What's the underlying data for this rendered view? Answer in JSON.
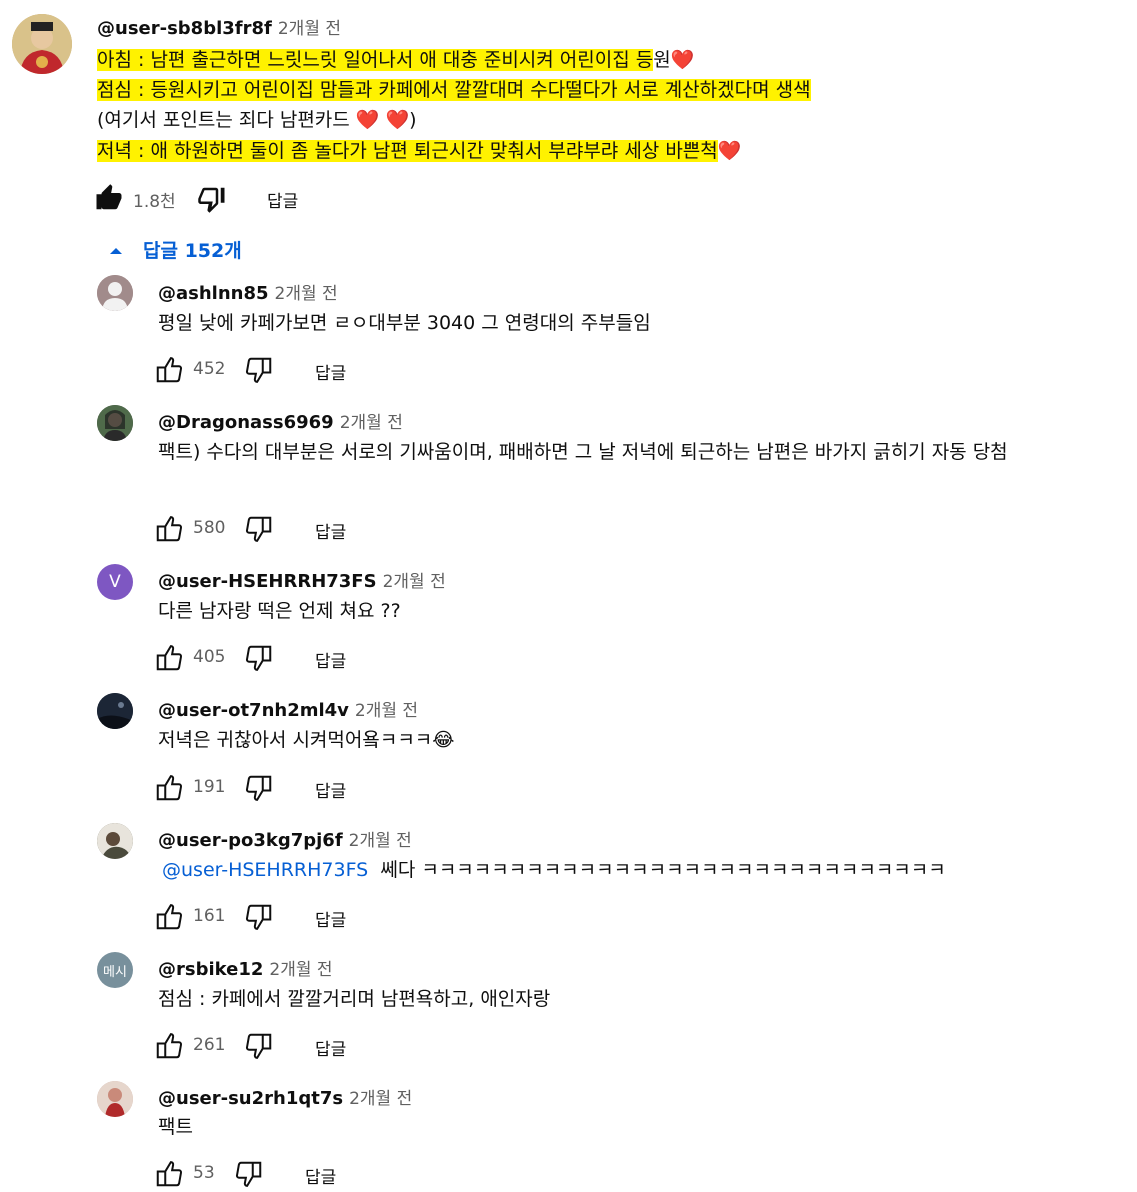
{
  "main_comment": {
    "author": "@user-sb8bl3fr8f",
    "time": "2개월 전",
    "lines": [
      {
        "label": "아침 : ",
        "hl_text": "남편 출근하면 느릿느릿 일어나서 애 대충 준비시켜 어린이집 등",
        "tail": "원"
      },
      {
        "label": "점심 : ",
        "hl_text": "등원시키고 어린이집 맘들과 카페에서 깔깔대며 수다떨다가 서로 계산하겠다며 생색",
        "tail": ""
      },
      {
        "label": "",
        "hl_text": "",
        "tail": "(여기서 포인트는 죄다 남편카드 ❤️ ❤️)"
      },
      {
        "label": "저녁 : ",
        "hl_text": "애 하원하면 둘이 좀 놀다가 남편 퇴근시간 맞춰서 부랴부랴 세상 바쁜척",
        "tail": ""
      }
    ],
    "heart": "❤️",
    "likes": "1.8천",
    "reply_label": "답글"
  },
  "replies_toggle": {
    "label": "답글 152개"
  },
  "replies": [
    {
      "author": "@ashlnn85",
      "time": "2개월 전",
      "text": "평일 낮에 카페가보면 ㄹㅇ대부분 3040 그 연령대의 주부들임",
      "likes": "452",
      "reply_label": "답글",
      "avatar_color": "#8a7a7a"
    },
    {
      "author": "@Dragonass6969",
      "time": "2개월 전",
      "text": "팩트) 수다의 대부분은 서로의 기싸움이며, 패배하면 그 날 저녁에 퇴근하는 남편은 바가지 긁히기 자동 당첨",
      "likes": "580",
      "reply_label": "답글",
      "avatar_color": "#3b4a3a"
    },
    {
      "author": "@user-HSEHRRH73FS",
      "time": "2개월 전",
      "text": "다른 남자랑 떡은 언제 쳐요 ??",
      "likes": "405",
      "reply_label": "답글",
      "avatar_color": "#7e57c2",
      "avatar_letter": "V"
    },
    {
      "author": "@user-ot7nh2ml4v",
      "time": "2개월 전",
      "text": "저녁은 귀찮아서 시켜먹어욬ㅋㅋㅋ😂",
      "likes": "191",
      "reply_label": "답글",
      "avatar_color": "#1f2a3a"
    },
    {
      "author": "@user-po3kg7pj6f",
      "time": "2개월 전",
      "mention": "@user-HSEHRRH73FS",
      "text": "쎄다 ㅋㅋㅋㅋㅋㅋㅋㅋㅋㅋㅋㅋㅋㅋㅋㅋㅋㅋㅋㅋㅋㅋㅋㅋㅋㅋㅋㅋㅋㅋ",
      "likes": "161",
      "reply_label": "답글",
      "avatar_color": "#5a5a48"
    },
    {
      "author": "@rsbike12",
      "time": "2개월 전",
      "text": "점심 : 카페에서 깔깔거리며 남편욕하고, 애인자랑",
      "likes": "261",
      "reply_label": "답글",
      "avatar_color": "#78909c",
      "avatar_letter": "메시"
    },
    {
      "author": "@user-su2rh1qt7s",
      "time": "2개월 전",
      "text": "팩트",
      "likes": "53",
      "reply_label": "답글",
      "avatar_color": "#c9a9a0"
    }
  ]
}
